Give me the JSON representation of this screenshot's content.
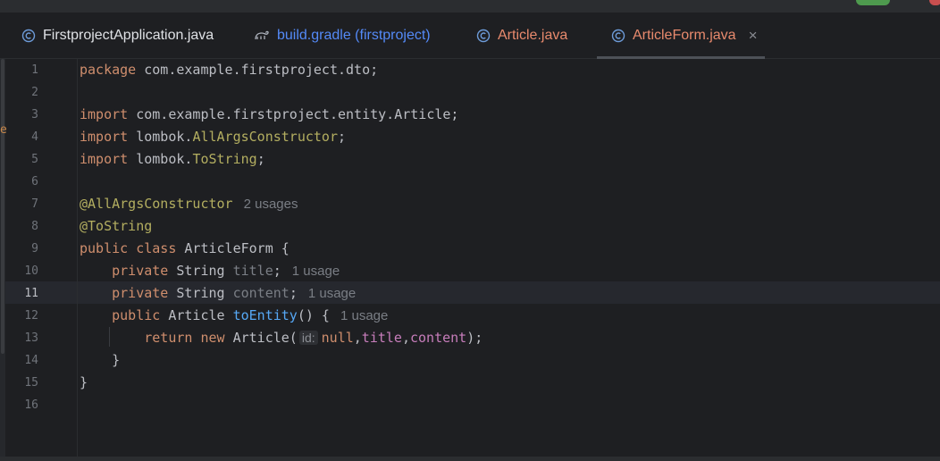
{
  "tabs": [
    {
      "label": "FirstprojectApplication.java",
      "icon": "java-class-icon",
      "color": "#dfe1e5"
    },
    {
      "label": "build.gradle (firstproject)",
      "icon": "gradle-icon",
      "color": "#548af7"
    },
    {
      "label": "Article.java",
      "icon": "class-c-icon",
      "color": "#e88a6d"
    },
    {
      "label": "ArticleForm.java",
      "icon": "class-c-icon",
      "color": "#e88a6d",
      "active": true
    }
  ],
  "tab_close": "×",
  "editor": {
    "current_line": 11,
    "line_numbers": [
      "1",
      "2",
      "3",
      "4",
      "5",
      "6",
      "7",
      "8",
      "9",
      "10",
      "11",
      "12",
      "13",
      "14",
      "15",
      "16"
    ],
    "lines": {
      "l1": {
        "kw": "package",
        "rest": " com.example.firstproject.dto;"
      },
      "l3": {
        "kw": "import",
        "rest": " com.example.firstproject.entity.Article;"
      },
      "l4": {
        "kw": "import",
        "pkg": " lombok.",
        "ann": "AllArgsConstructor",
        "end": ";"
      },
      "l5": {
        "kw": "import",
        "pkg": " lombok.",
        "ann": "ToString",
        "end": ";"
      },
      "l7": {
        "ann": "@AllArgsConstructor",
        "hint": "2 usages"
      },
      "l8": {
        "ann": "@ToString"
      },
      "l9": {
        "kw1": "public",
        "kw2": " class",
        "rest": " ArticleForm {"
      },
      "l10": {
        "indent": "    ",
        "kw": "private",
        "type": " String ",
        "field": "title",
        "end": ";",
        "hint": "1 usage"
      },
      "l11": {
        "indent": "    ",
        "kw": "private",
        "type": " String ",
        "field": "content",
        "end": ";",
        "hint": "1 usage"
      },
      "l12": {
        "indent": "    ",
        "kw": "public",
        "type": " Article ",
        "fn": "toEntity",
        "end": "() {",
        "hint": "1 usage"
      },
      "l13": {
        "indent": "        ",
        "kw1": "return",
        "kw2": " new",
        "rest": " Article(",
        "inlay": "id:",
        "nul": "null",
        "comma1": ",",
        "f1": "title",
        "comma2": ",",
        "f2": "content",
        "end": ");"
      },
      "l14": {
        "text": "    }"
      },
      "l15": {
        "text": "}"
      }
    }
  },
  "colors": {
    "background": "#1e1f22",
    "keyword": "#cf8e6d",
    "annotation": "#b3ae60",
    "field": "#c77dbb",
    "function": "#56a8f5",
    "default_text": "#bcbec4"
  }
}
